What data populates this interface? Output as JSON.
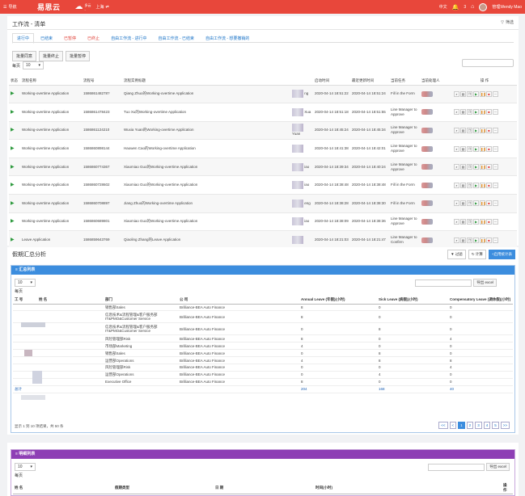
{
  "topbar": {
    "nav_label": "导航",
    "logo": "易思云",
    "temp": "多云",
    "temp_range": "-",
    "city": "上海",
    "lang": "中文",
    "badge": "3",
    "user": "管理Wendy Mao"
  },
  "panel1": {
    "title": "工作流 - 清单",
    "filter": "筛选",
    "tabs": [
      "进行中",
      "已结束",
      "已暂停",
      "已终止",
      "自由工作流 - 进行中",
      "自由工作流 - 已结束",
      "自由工作流 - 想要撤销的"
    ],
    "batch": [
      "批量同意",
      "批量终止",
      "批量暂停"
    ],
    "perpage_label": "每页",
    "perpage_value": "10",
    "columns": [
      "状态",
      "流程名称",
      "流程号",
      "流程实例标题",
      "",
      "启动时间",
      "最近更新时间",
      "当前任务",
      "当前处理人",
      "操 作"
    ],
    "rows": [
      {
        "name": "Working-overtime Application",
        "no": "158686148278?",
        "title": "Qiang Zhuo的Working-overtime Application",
        "c5": "ng",
        "start": "2020-04-14 18:51:22",
        "upd": "2020-04-14 18:51:24",
        "task": "Fill in the Form"
      },
      {
        "name": "Working-overtime Application",
        "no": "1586861478423",
        "title": "Tuo Xu的Working-overtime Application",
        "c5": "Xua",
        "start": "2020-04-14 18:51:18",
        "upd": "2020-04-14 18:51:55",
        "task": "Line Manager to Approve"
      },
      {
        "name": "Working-overtime Application",
        "no": "1586861124210",
        "title": "Wuxia Yuan的Working-overtime Application",
        "c5": "Yuan",
        "start": "2020-04-14 18:45:24",
        "upd": "2020-04-14 18:45:34",
        "task": "Line Manager to Approve"
      },
      {
        "name": "Working-overtime Application",
        "no": "1586860898144",
        "title": "Haowen Cao的Working-overtime Application",
        "c5": "",
        "start": "2020-04-14 18:41:38",
        "upd": "2020-04-14 18:42:01",
        "task": "Line Manager to Approve"
      },
      {
        "name": "Working-overtime Application",
        "no": "1586860774367",
        "title": "Xiaomiao Guo的Working-overtime Application",
        "c5": "iao",
        "start": "2020-04-14 18:39:34",
        "upd": "2020-04-14 18:40:24",
        "task": "Line Manager to Approve"
      },
      {
        "name": "Working-overtime Application",
        "no": "1586860728602",
        "title": "Xiaomiao Guo的Working-overtime Application",
        "c5": "iao",
        "start": "2020-04-14 18:38:48",
        "upd": "2020-04-14 18:38:48",
        "task": "Fill in the Form"
      },
      {
        "name": "Working-overtime Application",
        "no": "1586860708897",
        "title": "Jiang Zhuo的Working-overtime Application",
        "c5": "eng",
        "start": "2020-04-14 18:38:28",
        "upd": "2020-04-14 18:38:30",
        "task": "Fill in the Form"
      },
      {
        "name": "Working-overtime Application",
        "no": "1586860689801",
        "title": "Xiaomiao Guo的Working-overtime Application",
        "c5": "iao",
        "start": "2020-04-14 18:38:09",
        "upd": "2020-04-14 18:38:36",
        "task": "Line Manager to Approve"
      },
      {
        "name": "Leave Application",
        "no": "1586859643769",
        "title": "Qiaoling Zhang的Leave Application",
        "c5": "",
        "start": "2020-04-14 18:21:03",
        "upd": "2020-04-14 18:21:47",
        "task": "Line Manager to Confirm"
      }
    ]
  },
  "panel2": {
    "title": "假期汇总分析",
    "btn_filter": "过滤",
    "btn_calc": "计算",
    "btn_add": "启用统计表",
    "card_title": "汇总列表",
    "perpage_value": "10",
    "perpage_label": "每页",
    "export": "导出 excel",
    "columns": [
      "工 号",
      "姓 名",
      "部门",
      "公 司",
      "Annual Leave (年假)(小时)",
      "Sick Leave (病假)(小时)",
      "Compensatory Leave (调休假)(小时)"
    ],
    "rows": [
      {
        "dept": "销售部Sales",
        "co": "Brilliance-BEA Auto Finance",
        "al": "8",
        "sl": "0",
        "cl": "0"
      },
      {
        "dept": "信息技术&流程管理&客户服务部 IT&PMO&Customer Service",
        "co": "Brilliance-BEA Auto Finance",
        "al": "8",
        "sl": "0",
        "cl": "0"
      },
      {
        "dept": "信息技术&流程管理&客户服务部 IT&PMO&Customer Service",
        "co": "Brilliance-BEA Auto Finance",
        "al": "0",
        "sl": "8",
        "cl": "0"
      },
      {
        "dept": "风险管理部Risk",
        "co": "Brilliance-BEA Auto Finance",
        "al": "8",
        "sl": "0",
        "cl": "4"
      },
      {
        "dept": "市场部Marketing",
        "co": "Brilliance-BEA Auto Finance",
        "al": "4",
        "sl": "0",
        "cl": "0"
      },
      {
        "dept": "销售部Sales",
        "co": "Brilliance-BEA Auto Finance",
        "al": "0",
        "sl": "8",
        "cl": "0"
      },
      {
        "dept": "运营部Operations",
        "co": "Brilliance-BEA Auto Finance",
        "al": "4",
        "sl": "8",
        "cl": "8"
      },
      {
        "dept": "风险管理部Risk",
        "co": "Brilliance-BEA Auto Finance",
        "al": "0",
        "sl": "0",
        "cl": "4"
      },
      {
        "dept": "运营部Operations",
        "co": "Brilliance-BEA Auto Finance",
        "al": "0",
        "sl": "4",
        "cl": "0"
      },
      {
        "dept": "Executive Office",
        "co": "Brilliance-BEA Auto Finance",
        "al": "8",
        "sl": "0",
        "cl": "0"
      }
    ],
    "total": {
      "label": "总计",
      "al": "204",
      "sl": "168",
      "cl": "40"
    },
    "showing": "显示 1 到 10 项结果，共 50 条",
    "pages": [
      "<<",
      "<",
      "1",
      "2",
      "3",
      "4",
      "5",
      ">>"
    ]
  },
  "panel3": {
    "card_title": "明细列表",
    "perpage_value": "10",
    "perpage_label": "每页",
    "export": "导出 excel",
    "columns": [
      "姓 名",
      "假期类型",
      "日 期",
      "时间(小时)",
      "操 作"
    ]
  }
}
